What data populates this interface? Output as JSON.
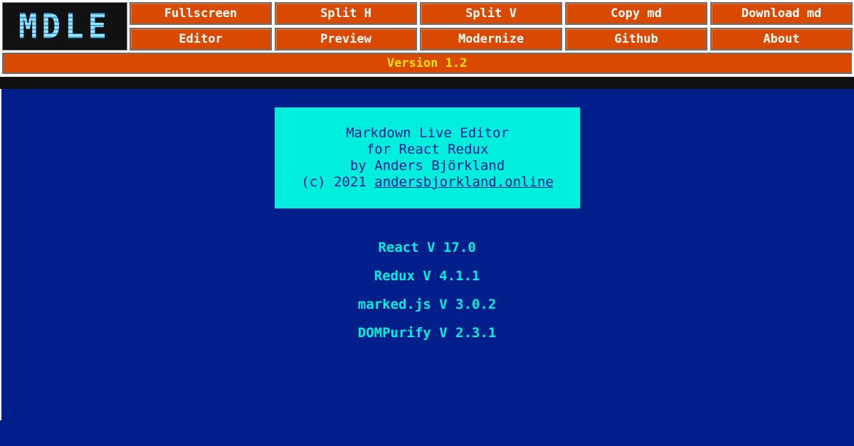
{
  "logo": {
    "text": "MDLE"
  },
  "toolbar": {
    "row1": [
      "Fullscreen",
      "Split H",
      "Split V",
      "Copy md",
      "Download md"
    ],
    "row2": [
      "Editor",
      "Preview",
      "Modernize",
      "Github",
      "About"
    ]
  },
  "version_label": "Version 1.2",
  "about": {
    "line1": "Markdown Live Editor",
    "line2": "for React Redux",
    "line3": "by Anders Björkland",
    "copyright_prefix": "(c) 2021",
    "link_text": "andersbjorkland.online"
  },
  "dependencies": [
    "React V 17.0",
    "Redux V 4.1.1",
    "marked.js V 3.0.2",
    "DOMPurify V 2.3.1"
  ],
  "colors": {
    "background": "#001f8a",
    "button": "#d94a00",
    "button_text": "#ffffff",
    "version_text": "#ffe000",
    "accent_cyan": "#00eedd"
  }
}
